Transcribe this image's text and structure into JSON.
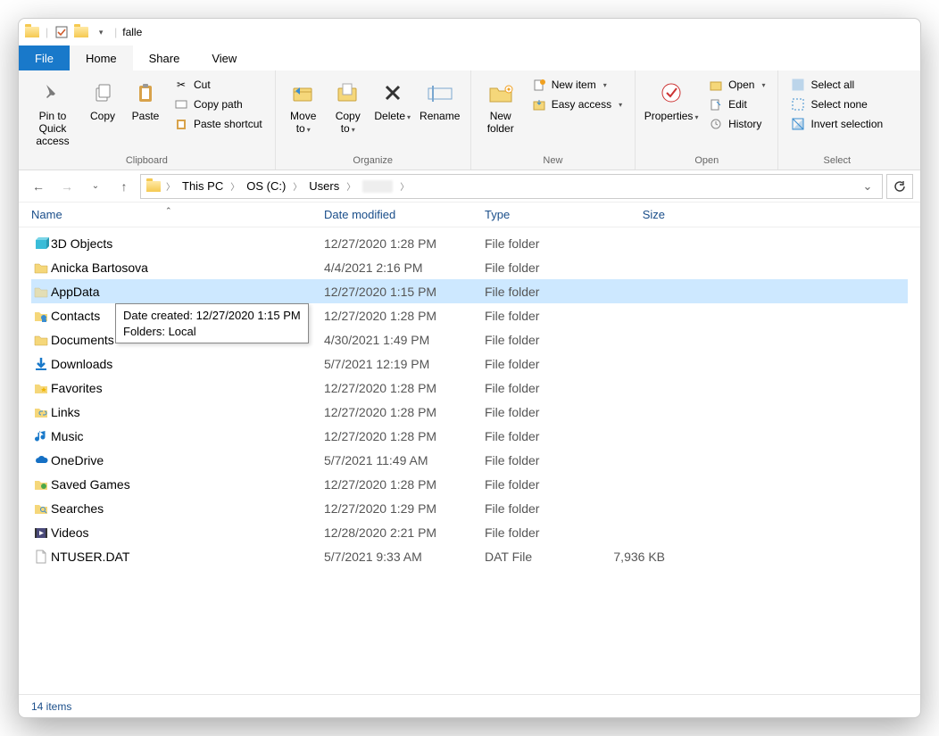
{
  "title": "falle",
  "tabs": {
    "file": "File",
    "home": "Home",
    "share": "Share",
    "view": "View"
  },
  "ribbon": {
    "clipboard": {
      "label": "Clipboard",
      "pin": "Pin to Quick access",
      "copy": "Copy",
      "paste": "Paste",
      "cut": "Cut",
      "copy_path": "Copy path",
      "paste_shortcut": "Paste shortcut"
    },
    "organize": {
      "label": "Organize",
      "move": "Move to",
      "copy": "Copy to",
      "delete": "Delete",
      "rename": "Rename"
    },
    "new": {
      "label": "New",
      "new_folder": "New folder",
      "new_item": "New item",
      "easy_access": "Easy access"
    },
    "open": {
      "label": "Open",
      "properties": "Properties",
      "open": "Open",
      "edit": "Edit",
      "history": "History"
    },
    "select": {
      "label": "Select",
      "all": "Select all",
      "none": "Select none",
      "invert": "Invert selection"
    }
  },
  "breadcrumb": [
    "This PC",
    "OS (C:)",
    "Users"
  ],
  "columns": {
    "name": "Name",
    "date": "Date modified",
    "type": "Type",
    "size": "Size"
  },
  "tooltip": {
    "line1": "Date created: 12/27/2020 1:15 PM",
    "line2": "Folders: Local"
  },
  "items": [
    {
      "name": "3D Objects",
      "date": "12/27/2020 1:28 PM",
      "type": "File folder",
      "size": "",
      "icon": "3d"
    },
    {
      "name": "Anicka Bartosova",
      "date": "4/4/2021 2:16 PM",
      "type": "File folder",
      "size": "",
      "icon": "folder"
    },
    {
      "name": "AppData",
      "date": "12/27/2020 1:15 PM",
      "type": "File folder",
      "size": "",
      "icon": "folder-faded",
      "selected": true
    },
    {
      "name": "Contacts",
      "date": "12/27/2020 1:28 PM",
      "type": "File folder",
      "size": "",
      "icon": "contacts"
    },
    {
      "name": "Documents",
      "date": "4/30/2021 1:49 PM",
      "type": "File folder",
      "size": "",
      "icon": "folder"
    },
    {
      "name": "Downloads",
      "date": "5/7/2021 12:19 PM",
      "type": "File folder",
      "size": "",
      "icon": "download"
    },
    {
      "name": "Favorites",
      "date": "12/27/2020 1:28 PM",
      "type": "File folder",
      "size": "",
      "icon": "favorites"
    },
    {
      "name": "Links",
      "date": "12/27/2020 1:28 PM",
      "type": "File folder",
      "size": "",
      "icon": "links"
    },
    {
      "name": "Music",
      "date": "12/27/2020 1:28 PM",
      "type": "File folder",
      "size": "",
      "icon": "music"
    },
    {
      "name": "OneDrive",
      "date": "5/7/2021 11:49 AM",
      "type": "File folder",
      "size": "",
      "icon": "onedrive"
    },
    {
      "name": "Saved Games",
      "date": "12/27/2020 1:28 PM",
      "type": "File folder",
      "size": "",
      "icon": "games"
    },
    {
      "name": "Searches",
      "date": "12/27/2020 1:29 PM",
      "type": "File folder",
      "size": "",
      "icon": "search"
    },
    {
      "name": "Videos",
      "date": "12/28/2020 2:21 PM",
      "type": "File folder",
      "size": "",
      "icon": "videos"
    },
    {
      "name": "NTUSER.DAT",
      "date": "5/7/2021 9:33 AM",
      "type": "DAT File",
      "size": "7,936 KB",
      "icon": "file"
    }
  ],
  "status": "14 items"
}
